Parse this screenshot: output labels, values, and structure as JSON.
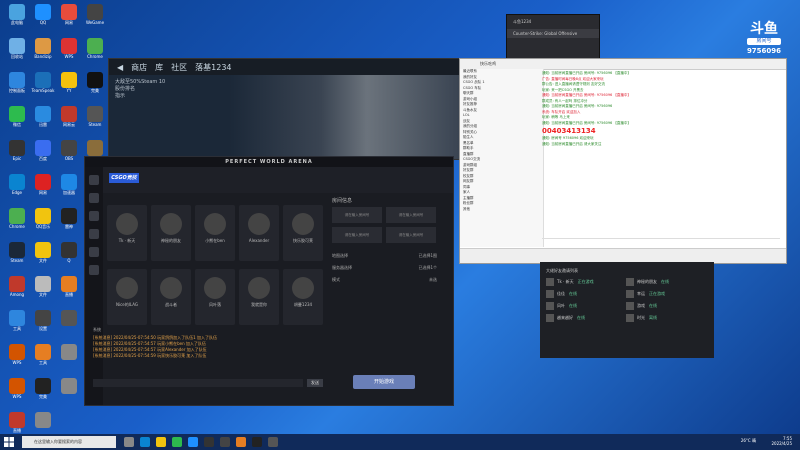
{
  "desktop": {
    "icons": [
      {
        "label": "此电脑",
        "color": "#4aa3df"
      },
      {
        "label": "QQ",
        "color": "#1e90ff"
      },
      {
        "label": "网易",
        "color": "#e74c3c"
      },
      {
        "label": "WeGame",
        "color": "#444"
      },
      {
        "label": "回收站",
        "color": "#6fb0e6"
      },
      {
        "label": "Bandizip",
        "color": "#d94"
      },
      {
        "label": "WPS",
        "color": "#d33"
      },
      {
        "label": "Chrome",
        "color": "#4caf50"
      },
      {
        "label": "控制面板",
        "color": "#2e86de"
      },
      {
        "label": "TeamSpeak",
        "color": "#1b6fb8"
      },
      {
        "label": "YY",
        "color": "#f4c20d"
      },
      {
        "label": "完美",
        "color": "#111"
      },
      {
        "label": "微信",
        "color": "#2dbb4e"
      },
      {
        "label": "迅雷",
        "color": "#2a8be0"
      },
      {
        "label": "网易云",
        "color": "#c0392b"
      },
      {
        "label": "Steam",
        "color": "#555"
      },
      {
        "label": "Epic",
        "color": "#333"
      },
      {
        "label": "百度",
        "color": "#3a6df0"
      },
      {
        "label": "OBS",
        "color": "#444"
      },
      {
        "label": "CS:GO",
        "color": "#8a6d3b"
      },
      {
        "label": "Edge",
        "color": "#0a84d0"
      },
      {
        "label": "网易",
        "color": "#d22"
      },
      {
        "label": "加速器",
        "color": "#1e88e5"
      },
      {
        "label": "斗鱼",
        "color": "#e67e22"
      },
      {
        "label": "Chrome",
        "color": "#4caf50"
      },
      {
        "label": "QQ音乐",
        "color": "#f1c40f"
      },
      {
        "label": "雷神",
        "color": "#222"
      },
      {
        "label": "",
        "color": "#c0392b"
      },
      {
        "label": "Steam",
        "color": "#1b2838"
      },
      {
        "label": "文件",
        "color": "#f1c40f"
      },
      {
        "label": "Q",
        "color": "#333"
      },
      {
        "label": "",
        "color": "#777"
      },
      {
        "label": "Among",
        "color": "#c0392b"
      },
      {
        "label": "文件",
        "color": "#bbb"
      },
      {
        "label": "直播",
        "color": "#e67e22"
      },
      {
        "label": "",
        "color": "#555"
      },
      {
        "label": "工具",
        "color": "#2e86de"
      },
      {
        "label": "设置",
        "color": "#444"
      },
      {
        "label": "",
        "color": "#555"
      },
      {
        "label": "",
        "color": "#777"
      },
      {
        "label": "WPS",
        "color": "#d35400"
      },
      {
        "label": "工具",
        "color": "#e67e22"
      },
      {
        "label": "",
        "color": "#888"
      },
      {
        "label": "",
        "color": "#777"
      },
      {
        "label": "WPS",
        "color": "#d35400"
      },
      {
        "label": "完美",
        "color": "#222"
      },
      {
        "label": "",
        "color": "#888"
      },
      {
        "label": "QQ",
        "color": "#eee"
      },
      {
        "label": "直播",
        "color": "#c0392b"
      },
      {
        "label": "",
        "color": "#888"
      }
    ]
  },
  "mini_popup": {
    "line1": "斗鱼1234",
    "line2": "Counter-Strike: Global Offensive"
  },
  "douyu": {
    "brand": "斗鱼",
    "sub": "房间号",
    "room": "9756096"
  },
  "steam": {
    "nav": [
      "商店",
      "库",
      "社区",
      "落基1234"
    ],
    "side_items": [
      "大敌至50%Steam 10",
      "股份排名",
      "指示"
    ]
  },
  "pwa": {
    "title": "PERFECT WORLD ARENA",
    "logo": "CSGO竞技",
    "players_top": [
      "Tk · 新天",
      "神秘的朋友",
      "小熊在ben",
      "Alexander",
      "快乐胶可莱"
    ],
    "players_bottom": [
      "Nice的ILAG",
      "战斗者",
      "风叶落",
      "我就是你",
      "胡曼1234"
    ],
    "room": {
      "header": "房间信息",
      "boxes": [
        "请在输入房间号",
        "请在输入房间号",
        "请在输入房间号",
        "请在输入房间号"
      ],
      "rows": [
        "地图选择",
        "服务器选择",
        "模式"
      ],
      "row_vals": [
        "已选择1图",
        "已选择1个",
        "未选"
      ]
    },
    "log_header": "系统",
    "log": [
      "[系统消息] 2022/04/25-07:54:50 玩家鸽鸽加入了队伍1 加入了队伍",
      "[系统消息] 2022/04/25-07:54:57 玩家小熊在ben 加入了队伍",
      "[系统消息] 2022/04/25-07:54:57 玩家Alexander 加入了队伍",
      "[系统消息] 2022/04/25-07:54:59 玩家快乐胶可莱 加入了队伍"
    ],
    "send": "发送",
    "start": "开始游戏"
  },
  "qq": {
    "tab": "快乐吃鸡",
    "tree": [
      "最近联系",
      "我的好友",
      "CSGO 战队 1",
      "CSGO 车队",
      "聊天群",
      "游戏小组",
      "好友推荐",
      "斗鱼水友",
      "LOL",
      "战友",
      "我的分组",
      "特别关心",
      "陌生人",
      "黑名单",
      "群助手",
      "直播群",
      "CSGO交流",
      "游戏群组",
      "好友群",
      "校友群",
      "网友群",
      "同事",
      "家人",
      "主播群",
      "粉丝群",
      "其他"
    ],
    "chat": [
      "通知: 当前房间直播已开启 房间号: 9756096 【直播中】",
      "广告: 直播时间每日晚8点 欢迎大家来玩",
      "群公告: 进入直播间请遵守规则 友好交流",
      "玩家: 来一把CSGO 开黑去",
      "通知: 当前房间直播已开启 房间号: 9756096 【直播中】",
      "群成员: 有人一起吗 排位冲分",
      "通知: 当前房间直播已开启 房间号: 9756096",
      "系统: 车队开启 欢迎加入",
      "玩家: 稍等 马上来",
      "通知: 当前房间直播已开启 房间号: 9756096 【直播中】"
    ],
    "highlight": "00403413134",
    "chat_after": [
      "通知: 房间号 9756096 欢迎来玩",
      "通知: 当前房间直播已开启 请大家关注"
    ]
  },
  "friends": {
    "header": "大佬好友邀请列表",
    "list": [
      {
        "name": "Tk · 新天",
        "status": "正在游戏"
      },
      {
        "name": "神秘的朋友",
        "status": "在线"
      },
      {
        "name": "佳佳",
        "status": "在线"
      },
      {
        "name": "幸运",
        "status": "正在游戏"
      },
      {
        "name": "风叶",
        "status": "在线"
      },
      {
        "name": "游戏",
        "status": "在线"
      },
      {
        "name": "越来越好",
        "status": "在线"
      },
      {
        "name": "时光",
        "status": "离线"
      }
    ]
  },
  "taskbar": {
    "search_placeholder": "在这里输入你要搜索的内容",
    "weather": "26°C 晴",
    "time": "7:55",
    "date": "2022/4/25"
  }
}
